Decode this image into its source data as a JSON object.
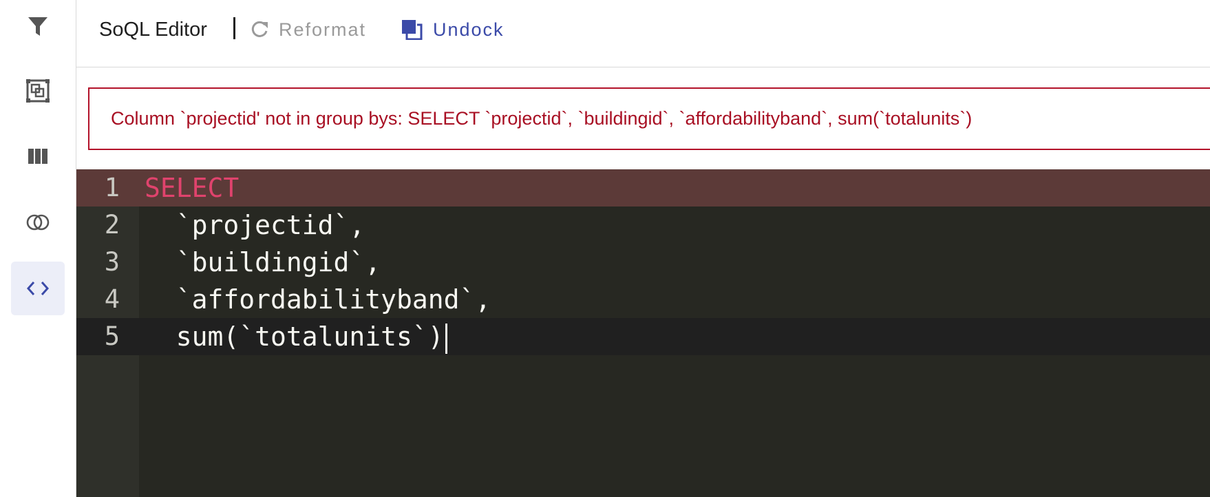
{
  "sidebar": {
    "items": [
      {
        "name": "filter",
        "icon": "filter-icon",
        "active": false
      },
      {
        "name": "group",
        "icon": "group-icon",
        "active": false
      },
      {
        "name": "columns",
        "icon": "columns-icon",
        "active": false
      },
      {
        "name": "join",
        "icon": "join-icon",
        "active": false
      },
      {
        "name": "code",
        "icon": "code-icon",
        "active": true
      }
    ]
  },
  "toolbar": {
    "title": "SoQL Editor",
    "reformat_label": "Reformat",
    "undock_label": "Undock"
  },
  "error": {
    "message": "Column `projectid' not in group bys: SELECT `projectid`, `buildingid`, `affordabilityband`, sum(`totalunits`)"
  },
  "editor": {
    "lines": [
      {
        "number": "1",
        "text": "SELECT"
      },
      {
        "number": "2",
        "text": "  `projectid`,"
      },
      {
        "number": "3",
        "text": "  `buildingid`,"
      },
      {
        "number": "4",
        "text": "  `affordabilityband`,"
      },
      {
        "number": "5",
        "text": "  sum(`totalunits`)"
      }
    ]
  },
  "colors": {
    "accent": "#3b4aa8",
    "error": "#b3132a",
    "keyword": "#e0436d",
    "editor_bg": "#272822"
  }
}
